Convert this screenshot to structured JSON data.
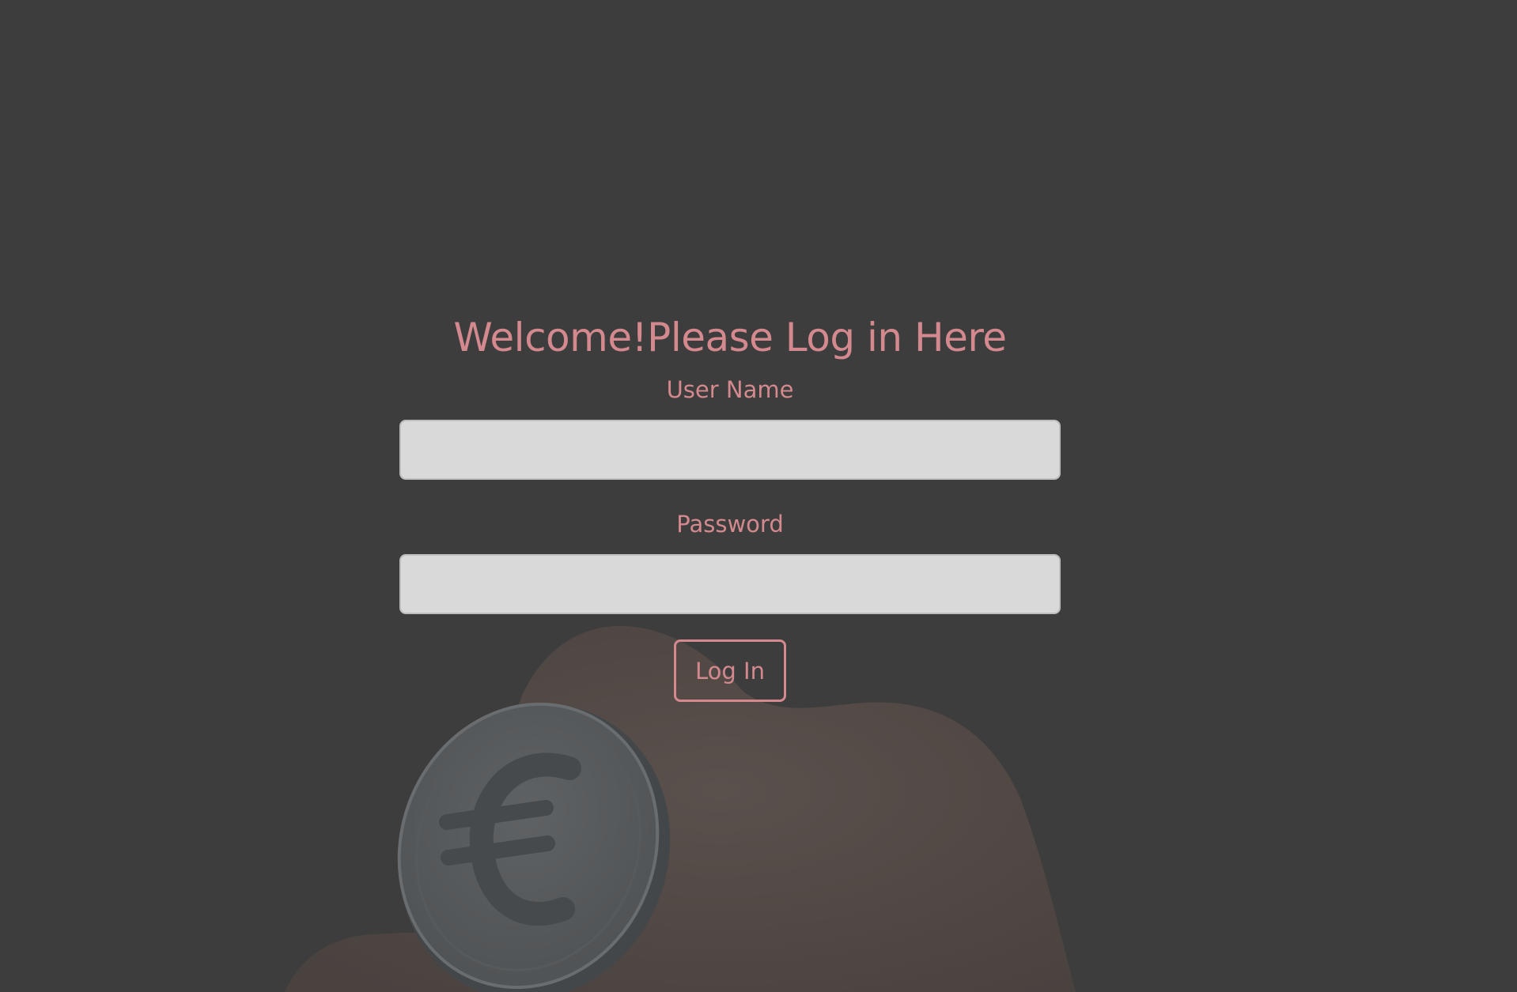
{
  "page": {
    "title": "Welcome!Please Log in Here"
  },
  "form": {
    "username_label": "User Name",
    "username_value": "",
    "password_label": "Password",
    "password_value": "",
    "submit_label": "Log In"
  },
  "background": {
    "image_subject": "hand-with-euro-coin",
    "icon": "euro-coin-icon"
  },
  "colors": {
    "accent": "#D3898E",
    "background": "#3D3D3D",
    "input_fill": "#D9D9D9"
  }
}
